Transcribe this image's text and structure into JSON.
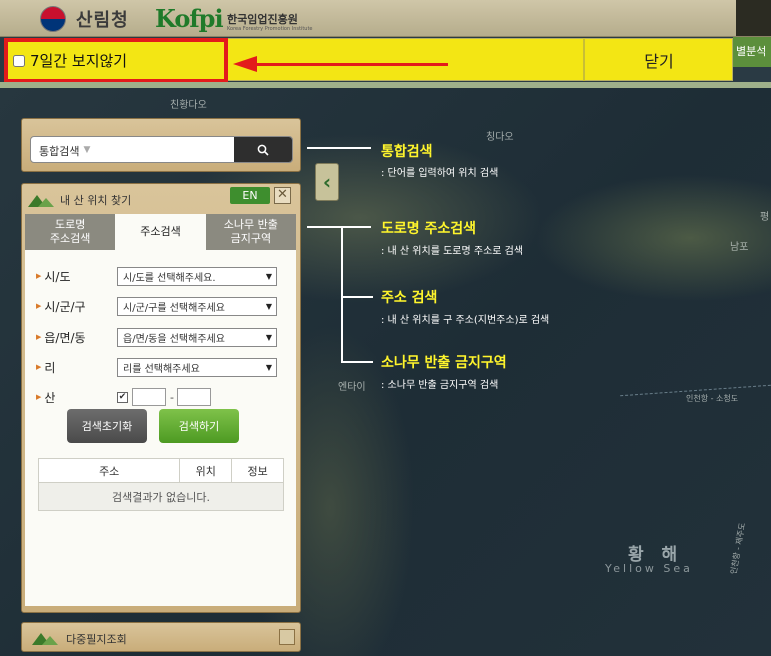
{
  "header": {
    "logo1_text": "산림청",
    "logo2_text": "Kofpi",
    "logo2_kr": "한국임업진흥원",
    "logo2_en": "Korea Forestry Promotion Institute"
  },
  "popup": {
    "hide_label": "7일간 보지않기",
    "close_label": "닫기",
    "right_tab": "별분석"
  },
  "search": {
    "category": "통합검색"
  },
  "find_panel": {
    "title": "내 산 위치 찾기",
    "en_label": "EN",
    "close_glyph": "✕",
    "tabs": [
      "도로명\n주소검색",
      "주소검색",
      "소나무 반출\n금지구역"
    ],
    "fields": [
      {
        "label": "시/도",
        "value": "시/도를 선택해주세요."
      },
      {
        "label": "시/군/구",
        "value": "시/군/구를 선택해주세요"
      },
      {
        "label": "읍/면/동",
        "value": "읍/면/동을 선택해주세요"
      },
      {
        "label": "리",
        "value": "리를 선택해주세요"
      }
    ],
    "mountain_label": "산",
    "mountain_dash": "-",
    "reset_label": "검색초기화",
    "search_label": "검색하기",
    "table_headers": [
      "주소",
      "위치",
      "정보"
    ],
    "empty_message": "검색결과가 없습니다."
  },
  "bottom_panel": {
    "title": "다중필지조회"
  },
  "annotations": [
    {
      "title": "통합검색",
      "desc": ": 단어를 입력하여 위치 검색"
    },
    {
      "title": "도로명 주소검색",
      "desc": ": 내 산 위치를 도로명 주소로 검색"
    },
    {
      "title": "주소 검색",
      "desc": ": 내 산 위치를 구 주소(지번주소)로 검색"
    },
    {
      "title": "소나무 반출 금지구역",
      "desc": ": 소나무 반출 금지구역 검색"
    }
  ],
  "map": {
    "labels": [
      "친황다오",
      "평",
      "남포",
      "엔타이",
      "칭다오"
    ],
    "sea_name": "황 해",
    "sea_name_en": "Yellow Sea",
    "route_label1": "인천항 - 소청도",
    "route_label2": "인천항 - 제주도"
  },
  "colors": {
    "notice_yellow": "#f3e614",
    "highlight_red": "#e31b1b",
    "annotation_yellow": "#fff52c",
    "en_green": "#3e8e2e"
  }
}
